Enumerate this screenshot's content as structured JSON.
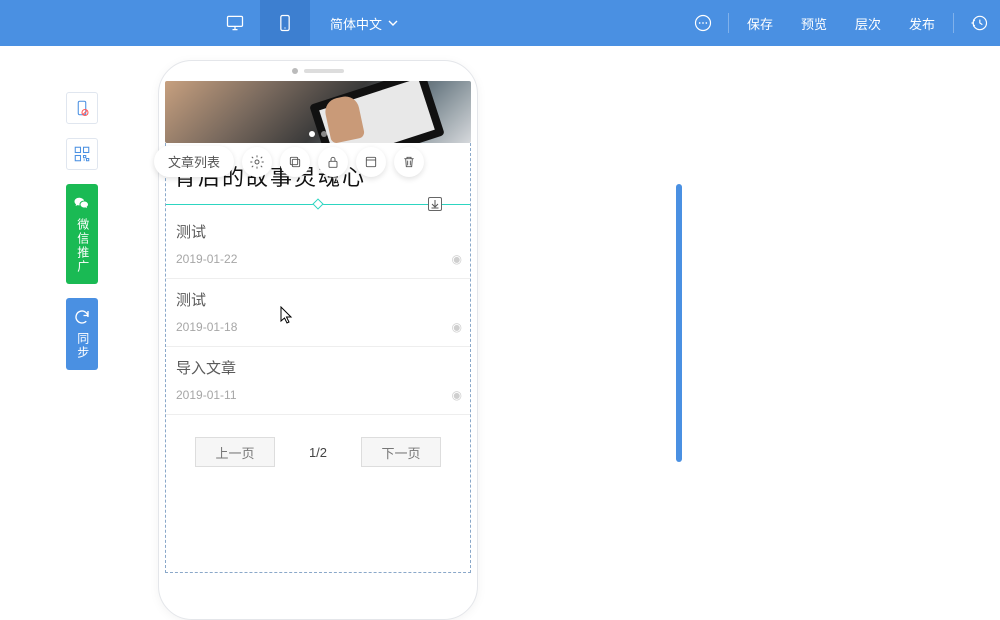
{
  "topbar": {
    "language": "简体中文",
    "buttons": {
      "save": "保存",
      "preview": "预览",
      "layers": "层次",
      "publish": "发布"
    }
  },
  "side": {
    "wechat": "微信推广",
    "sync": "同步"
  },
  "float_toolbar": {
    "label": "文章列表"
  },
  "heading": "背后的故事灵魂心",
  "articles": [
    {
      "title": "测试",
      "date": "2019-01-22"
    },
    {
      "title": "测试",
      "date": "2019-01-18"
    },
    {
      "title": "导入文章",
      "date": "2019-01-11"
    }
  ],
  "pagination": {
    "prev": "上一页",
    "next": "下一页",
    "indicator": "1/2"
  }
}
